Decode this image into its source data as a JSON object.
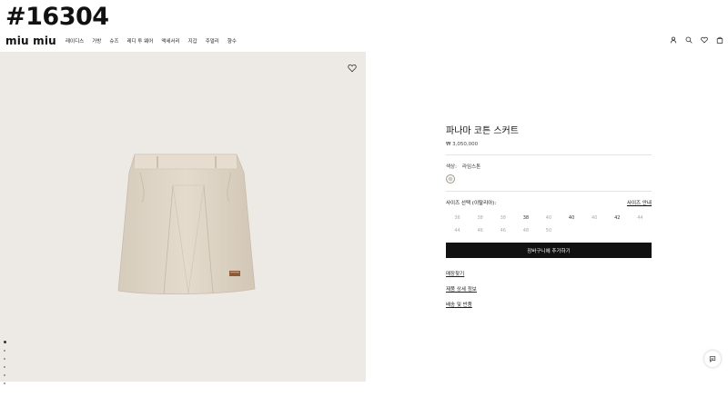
{
  "watermark": "#16304",
  "header": {
    "logo": "miu miu",
    "nav": [
      "레이디스",
      "가방",
      "슈즈",
      "레디 투 웨어",
      "액세서리",
      "지갑",
      "주얼리",
      "향수"
    ],
    "icons": [
      "account-icon",
      "search-icon",
      "wishlist-icon",
      "bag-icon"
    ]
  },
  "gallery": {
    "dots_count": 6,
    "active_dot": 0
  },
  "product": {
    "title": "파나마 코튼 스커트",
    "price": "₩ 3,050,000",
    "color_label": "색상:",
    "color_value": "라임스톤",
    "swatch_color": "#d8ccb8",
    "size_label": "사이즈 선택 (이탈리아):",
    "size_guide": "사이즈 안내",
    "sizes": [
      "36",
      "38",
      "38",
      "38",
      "40",
      "40",
      "40",
      "42",
      "44",
      "44",
      "46",
      "46",
      "48",
      "50"
    ],
    "add_to_cart": "장바구니에 추가하기",
    "links": [
      "매장찾기",
      "제품 상세 정보",
      "배송 및 반품"
    ]
  },
  "colors": {
    "image_bg": "#ede9e4",
    "button_bg": "#111111",
    "skirt": "#ddd3c4"
  }
}
